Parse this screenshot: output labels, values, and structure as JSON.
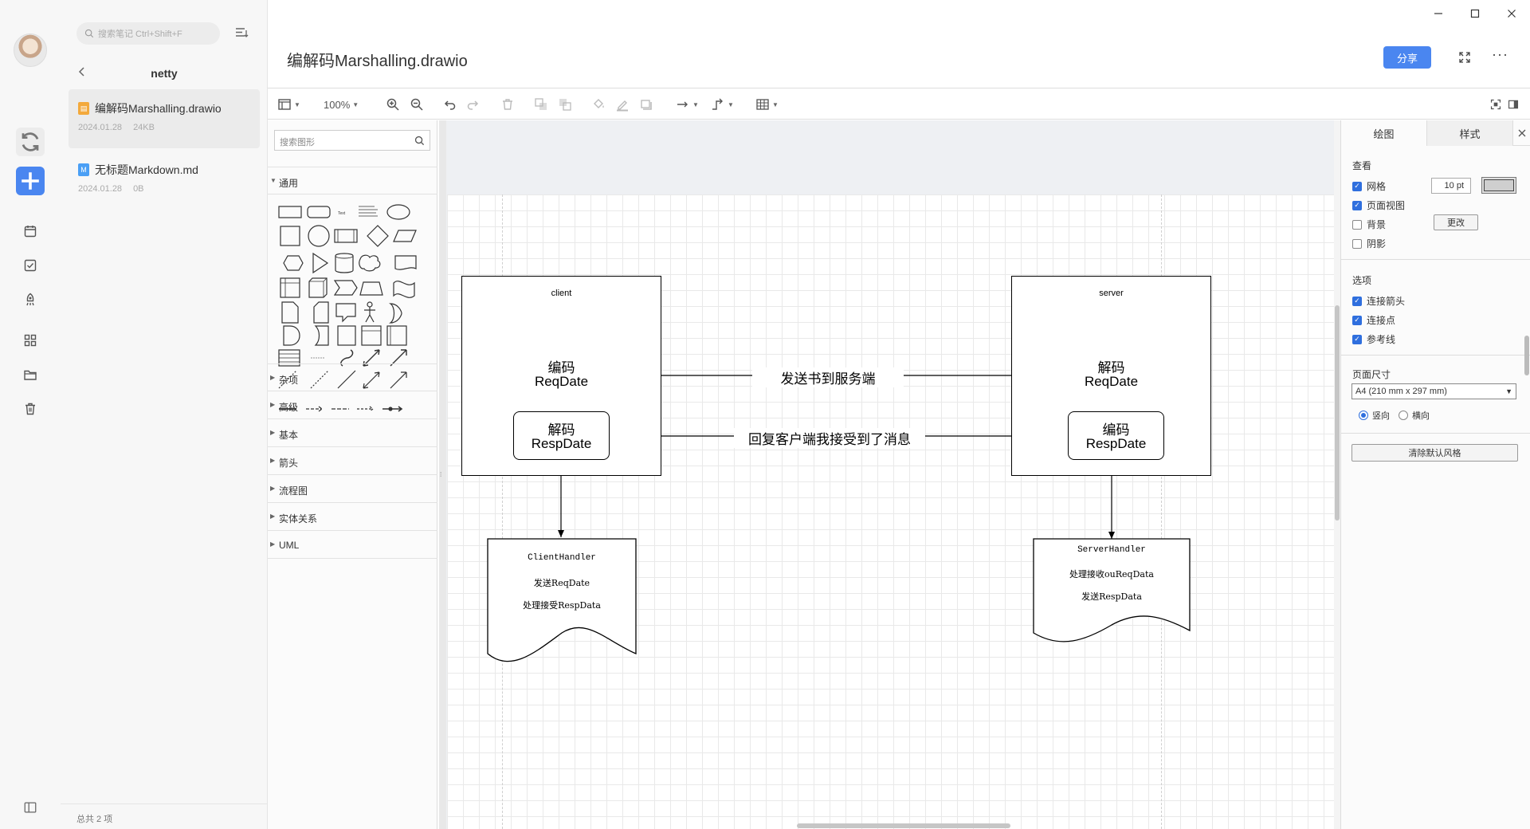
{
  "sidebar": {
    "search_placeholder": "搜索笔记 Ctrl+Shift+F",
    "folder_name": "netty",
    "notes": [
      {
        "title": "编解码Marshalling.drawio",
        "date": "2024.01.28",
        "size": "24KB",
        "type": "drawio"
      },
      {
        "title": "无标题Markdown.md",
        "date": "2024.01.28",
        "size": "0B",
        "type": "md"
      }
    ],
    "footer": "总共 2 项"
  },
  "header": {
    "title": "编解码Marshalling.drawio",
    "share_label": "分享"
  },
  "toolbar": {
    "zoom": "100%"
  },
  "shapes_panel": {
    "search_placeholder": "搜索图形",
    "sections": [
      "通用",
      "杂项",
      "高级",
      "基本",
      "箭头",
      "流程图",
      "实体关系",
      "UML"
    ]
  },
  "diagram": {
    "client": {
      "title": "client",
      "encode": "编码",
      "encode_sub": "ReqDate",
      "decode": "解码",
      "decode_sub": "RespDate"
    },
    "server": {
      "title": "server",
      "decode": "解码",
      "decode_sub": "ReqDate",
      "encode": "编码",
      "encode_sub": "RespDate"
    },
    "arrow_send": "发送书到服务端",
    "arrow_reply": "回复客户端我接受到了消息",
    "client_handler": {
      "l1": "ClientHandler",
      "l2": "发送ReqDate",
      "l3": "处理接受RespData"
    },
    "server_handler": {
      "l1": "ServerHandler",
      "l2": "处理接收ouReqData",
      "l3": "发送RespData"
    }
  },
  "format_panel": {
    "tab_diagram": "绘图",
    "tab_style": "样式",
    "view_title": "查看",
    "grid": "网格",
    "grid_size": "10 pt",
    "page_view": "页面视图",
    "background": "背景",
    "change": "更改",
    "shadow": "阴影",
    "options_title": "选项",
    "connection_arrows": "连接箭头",
    "connection_points": "连接点",
    "guides": "参考线",
    "page_size_title": "页面尺寸",
    "page_size": "A4 (210 mm x 297 mm)",
    "portrait": "竖向",
    "landscape": "横向",
    "reset_style": "清除默认风格"
  }
}
